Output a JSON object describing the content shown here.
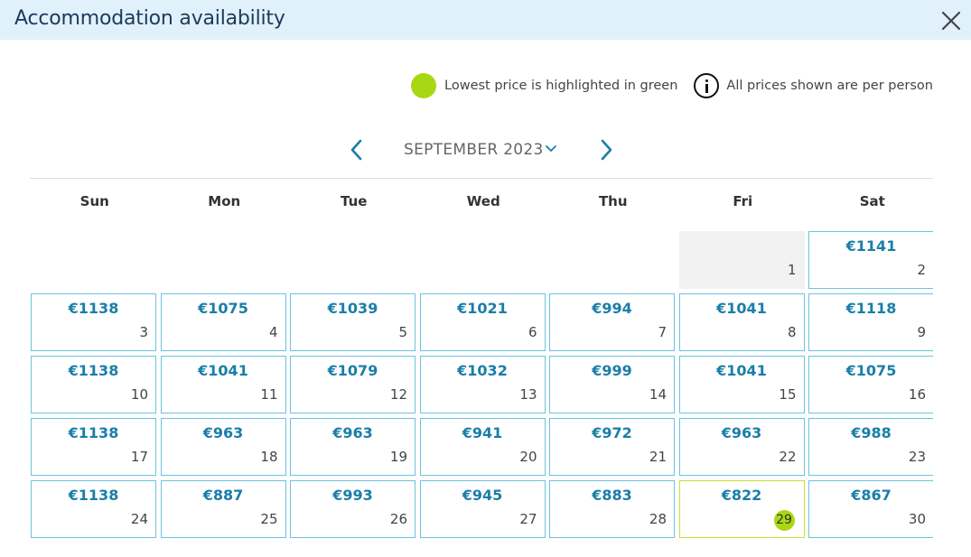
{
  "header": {
    "title": "Accommodation availability"
  },
  "legend": {
    "lowest_price_text": "Lowest price is highlighted in green",
    "per_person_text": "All prices shown are per person"
  },
  "month_nav": {
    "month": "SEPTEMBER 2023"
  },
  "weekdays": [
    "Sun",
    "Mon",
    "Tue",
    "Wed",
    "Thu",
    "Fri",
    "Sat"
  ],
  "colors": {
    "accent": "#1a7ea8",
    "border": "#6cc3df",
    "lowest": "#a8d813",
    "header_bg": "#e1f1fb"
  },
  "calendar": {
    "leading_blank_days": 5,
    "lowest_day": 29,
    "days": [
      {
        "day": "1",
        "price": null
      },
      {
        "day": "2",
        "price": "€1141"
      },
      {
        "day": "3",
        "price": "€1138"
      },
      {
        "day": "4",
        "price": "€1075"
      },
      {
        "day": "5",
        "price": "€1039"
      },
      {
        "day": "6",
        "price": "€1021"
      },
      {
        "day": "7",
        "price": "€994"
      },
      {
        "day": "8",
        "price": "€1041"
      },
      {
        "day": "9",
        "price": "€1118"
      },
      {
        "day": "10",
        "price": "€1138"
      },
      {
        "day": "11",
        "price": "€1041"
      },
      {
        "day": "12",
        "price": "€1079"
      },
      {
        "day": "13",
        "price": "€1032"
      },
      {
        "day": "14",
        "price": "€999"
      },
      {
        "day": "15",
        "price": "€1041"
      },
      {
        "day": "16",
        "price": "€1075"
      },
      {
        "day": "17",
        "price": "€1138"
      },
      {
        "day": "18",
        "price": "€963"
      },
      {
        "day": "19",
        "price": "€963"
      },
      {
        "day": "20",
        "price": "€941"
      },
      {
        "day": "21",
        "price": "€972"
      },
      {
        "day": "22",
        "price": "€963"
      },
      {
        "day": "23",
        "price": "€988"
      },
      {
        "day": "24",
        "price": "€1138"
      },
      {
        "day": "25",
        "price": "€887"
      },
      {
        "day": "26",
        "price": "€993"
      },
      {
        "day": "27",
        "price": "€945"
      },
      {
        "day": "28",
        "price": "€883"
      },
      {
        "day": "29",
        "price": "€822"
      },
      {
        "day": "30",
        "price": "€867"
      }
    ]
  }
}
